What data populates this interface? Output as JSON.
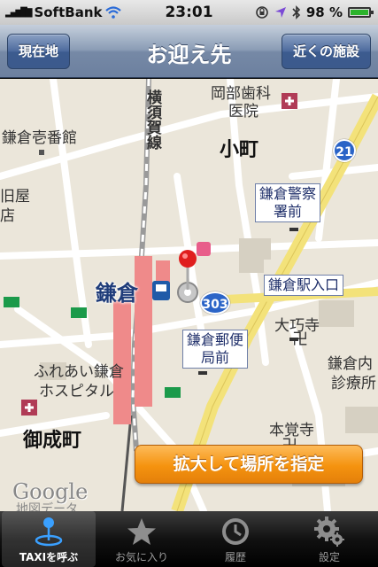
{
  "status_bar": {
    "carrier": "SoftBank",
    "time": "23:01",
    "battery": "98 %",
    "battery_level": 0.98,
    "icons": [
      "signal-icon",
      "wifi-icon",
      "rotation-lock-icon",
      "location-arrow-icon",
      "bluetooth-icon",
      "battery-icon"
    ]
  },
  "nav": {
    "title": "お迎え先",
    "left_button": "現在地",
    "right_button": "近くの施設"
  },
  "map": {
    "labels": {
      "okabe": "岡部歯科",
      "okabe2": "医院",
      "kamakura_ichiban": "鎌倉壱番館",
      "yokosuka_line": "横須賀線",
      "komachi": "小町",
      "police": "鎌倉警察",
      "police2": "署前",
      "station": "鎌倉",
      "station_entrance": "鎌倉駅入口",
      "post": "鎌倉郵便",
      "post2": "局前",
      "daigyoji": "大巧寺",
      "fureai": "ふれあい鎌倉",
      "fureai2": "ホスピタル",
      "kamakura_uchi": "鎌倉内",
      "clinic": "診療所",
      "onarimachi": "御成町",
      "hongakuji": "本覚寺",
      "left_edge1": "旧屋",
      "left_edge2": "店",
      "route_21": "21",
      "route_303": "303"
    },
    "google_logo": "Google",
    "google_sub": "地図データ",
    "zoom_button": "拡大して場所を指定"
  },
  "tabs": [
    {
      "label": "TAXIを呼ぶ",
      "icon": "taxi-pin-icon",
      "active": true
    },
    {
      "label": "お気に入り",
      "icon": "star-icon",
      "active": false
    },
    {
      "label": "履歴",
      "icon": "clock-icon",
      "active": false
    },
    {
      "label": "設定",
      "icon": "gear-icon",
      "active": false
    }
  ]
}
